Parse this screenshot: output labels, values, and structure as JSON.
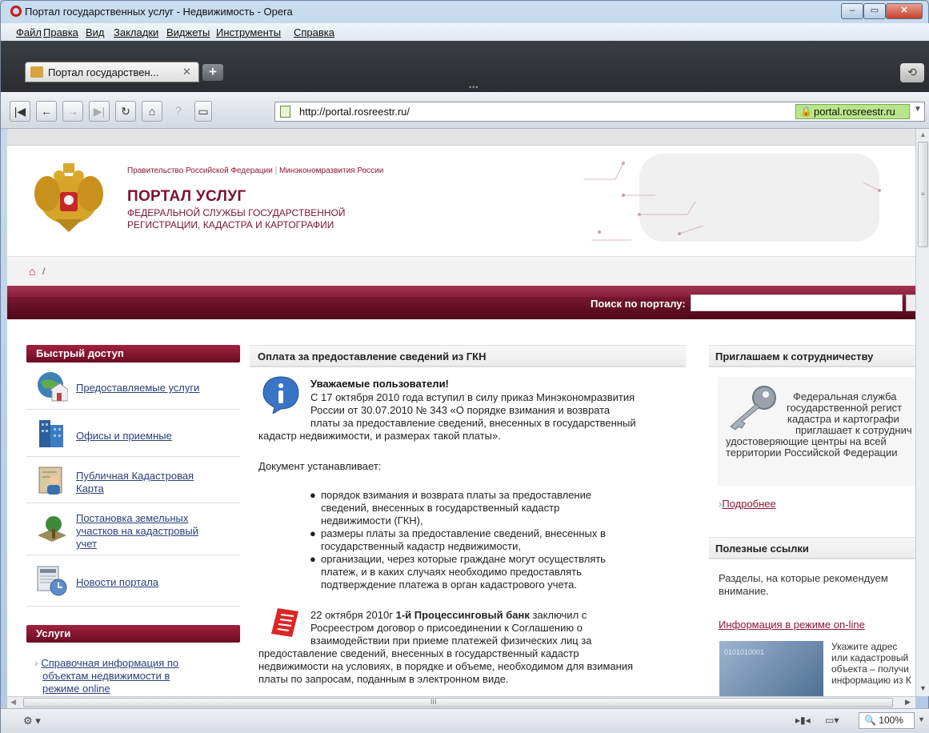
{
  "window": {
    "title": "Портал государственных услуг - Недвижимость - Opera",
    "min": "–",
    "max": "▭",
    "close": "✕"
  },
  "menu": [
    "Файл",
    "Правка",
    "Вид",
    "Закладки",
    "Виджеты",
    "Инструменты",
    "Справка"
  ],
  "tab": {
    "label": "Портал государствен...",
    "close": "✕",
    "new": "+"
  },
  "address": {
    "url": "http://portal.rosreestr.ru/",
    "domain": "portal.rosreestr.ru",
    "lock": "🔒"
  },
  "statusbar": {
    "zoom": "100%"
  },
  "site": {
    "gov_link1": "Правительство Российской Федерации",
    "gov_sep": " | ",
    "gov_link2": "Минэкономразвития России",
    "portal_title": "ПОРТАЛ УСЛУГ",
    "portal_sub1": "ФЕДЕРАЛЬНОЙ СЛУЖБЫ ГОСУДАРСТВЕННОЙ",
    "portal_sub2": "РЕГИСТРАЦИИ, КАДАСТРА И КАРТОГРАФИИ",
    "breadcrumb_sep": "/",
    "search_label": "Поиск по порталу:",
    "quick_access": {
      "title": "Быстрый доступ",
      "items": [
        {
          "line1": "Предоставляемые услуги",
          "line2": "",
          "line3": ""
        },
        {
          "line1": "Офисы и приемные",
          "line2": "",
          "line3": ""
        },
        {
          "line1": "Публичная Кадастровая",
          "line2": "Карта",
          "line3": ""
        },
        {
          "line1": "Постановка земельных",
          "line2": "участков на кадастровый",
          "line3": "учет"
        },
        {
          "line1": "Новости портала",
          "line2": "",
          "line3": ""
        }
      ]
    },
    "services": {
      "title": "Услуги",
      "item_line1": "Справочная информация по",
      "item_line2": "объектам недвижимости в",
      "item_line3": "режиме online"
    },
    "center": {
      "title": "Оплата за предоставление сведений из ГКН",
      "notice_title": "Уважаемые пользователи!",
      "notice_lines": [
        "С 17 октября 2010 года вступил в силу приказ Минэкономразвития",
        "России от 30.07.2010 № 343 «О порядке взимания и возврата",
        "платы за предоставление сведений, внесенных в государственный",
        "кадастр недвижимости, и размерах такой платы»."
      ],
      "doc_intro": "Документ устанавливает:",
      "bullets": [
        [
          "порядок взимания и возврата платы за предоставление",
          "сведений, внесенных в государственный кадастр",
          "недвижимости (ГКН),"
        ],
        [
          "размеры платы за предоставление сведений, внесенных в",
          "государственный кадастр недвижимости,"
        ],
        [
          "организации, через которые граждане могут осуществлять",
          "платеж, и в каких случаях необходимо предоставлять",
          "подтверждение платежа в орган кадастрового учета."
        ]
      ],
      "bank_prefix": "22 октября 2010г ",
      "bank_name": "1-й Процессинговый банк",
      "bank_suffix": " заключил с",
      "bank_lines": [
        "Росреестром договор о присоединении к Соглашению о",
        "взаимодействии при приеме платежей физических лиц за",
        "предоставление сведений, внесенных в государственный кадастр",
        "недвижимости на условиях, в порядке и объеме, необходимом для взимания",
        "платы по запросам, поданным в электронном виде."
      ]
    },
    "right": {
      "coop_title": "Приглашаем к сотрудничеству",
      "coop_lines": [
        "Федеральная служба",
        "государственной регист",
        "кадастра и картографи",
        "приглашает к сотруднич",
        "удостоверяющие центры на всей",
        "территории Российской Федерации"
      ],
      "more": "Подробнее",
      "links_title": "Полезные ссылки",
      "links_intro1": "Разделы, на которые рекомендуем",
      "links_intro2": "внимание.",
      "online_link": "Информация в режиме on-line",
      "online_img_text": "0101010001",
      "online_lines": [
        "Укажите адрес",
        "или кадастровый",
        "объекта – получи",
        "информацию из К"
      ]
    }
  },
  "colors": {
    "brand": "#7a1430",
    "band": "#6c0b22",
    "link": "#2a3f7a"
  }
}
